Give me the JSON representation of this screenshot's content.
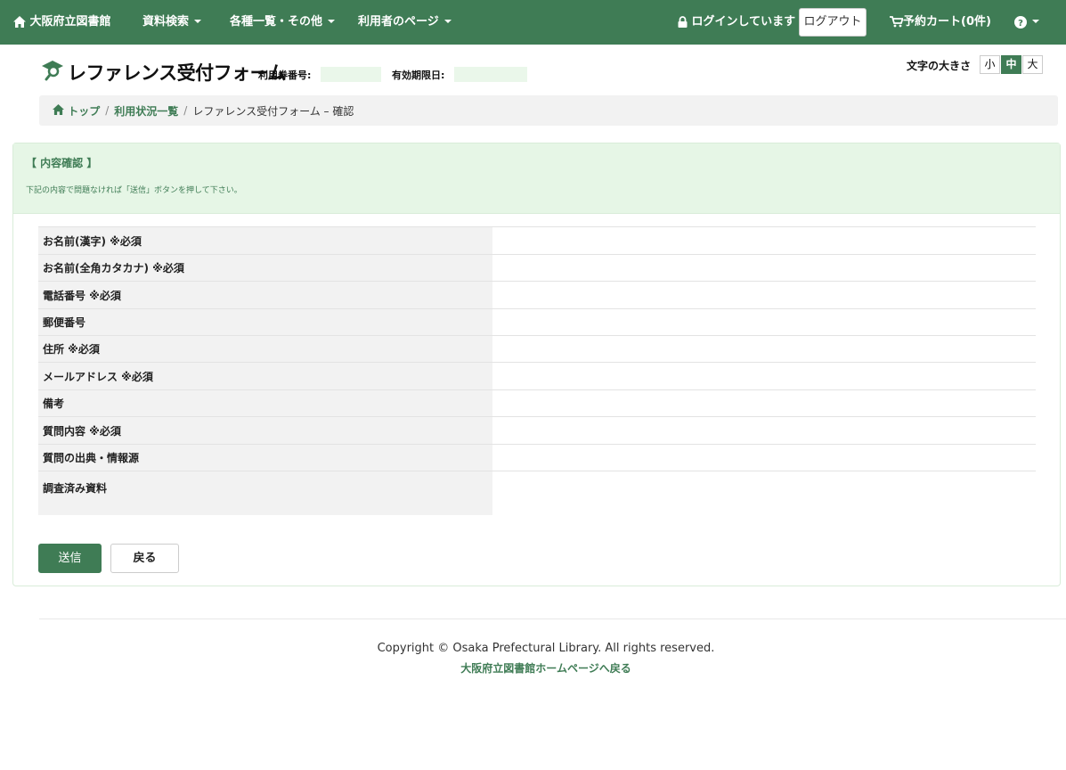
{
  "colors": {
    "brand": "#3f7c55",
    "panel_head_bg": "#e6f6e6",
    "meta_value_bg": "#eaf7ea"
  },
  "navbar": {
    "home_label": "大阪府立図書館",
    "home_icon": "home-icon",
    "menus": [
      {
        "label": "資料検索"
      },
      {
        "label": "各種一覧・その他"
      },
      {
        "label": "利用者のページ"
      }
    ],
    "login_status": "ログインしています",
    "login_icon": "lock-icon",
    "logout_label": "ログアウト",
    "cart_label": "予約カート(0件)",
    "cart_icon": "cart-icon",
    "help_icon": "question-circle-icon"
  },
  "header": {
    "title": "レファレンス受付フォーム",
    "title_icon": "magnifier-icon",
    "card_number_label": "利用券番号:",
    "card_number_value": "",
    "expiry_label": "有効期限日:",
    "expiry_value": "",
    "font_size_label": "文字の大きさ",
    "font_sizes": [
      {
        "label": "小",
        "active": false
      },
      {
        "label": "中",
        "active": true
      },
      {
        "label": "大",
        "active": false
      }
    ]
  },
  "breadcrumb": {
    "items": [
      {
        "label": "トップ",
        "icon": "home-icon"
      },
      {
        "label": "利用状況一覧"
      }
    ],
    "current": "レファレンス受付フォーム – 確認"
  },
  "panel": {
    "title": "【 内容確認 】",
    "description": "下記の内容で問題なければ「送信」ボタンを押して下さい。",
    "rows": [
      {
        "label": "お名前(漢字) ※必須",
        "value": ""
      },
      {
        "label": "お名前(全角カタカナ) ※必須",
        "value": ""
      },
      {
        "label": "電話番号 ※必須",
        "value": ""
      },
      {
        "label": "郵便番号",
        "value": ""
      },
      {
        "label": "住所 ※必須",
        "value": ""
      },
      {
        "label": "メールアドレス ※必須",
        "value": ""
      },
      {
        "label": "備考",
        "value": ""
      },
      {
        "label": "質問内容 ※必須",
        "value": ""
      },
      {
        "label": "質問の出典・情報源",
        "value": ""
      },
      {
        "label": "調査済み資料",
        "value": ""
      }
    ],
    "send_label": "送信",
    "back_label": "戻る"
  },
  "footer": {
    "copyright": "Copyright © Osaka Prefectural Library. All rights reserved.",
    "home_link": "大阪府立図書館ホームページへ戻る"
  }
}
